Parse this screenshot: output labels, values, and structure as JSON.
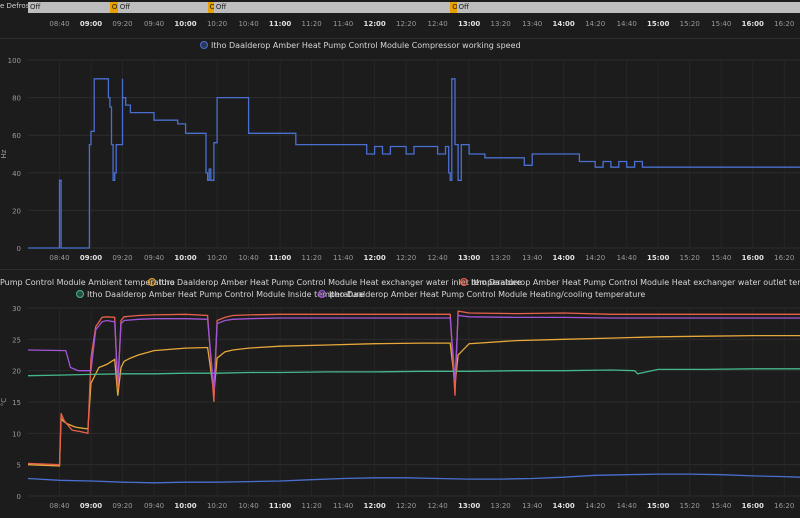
{
  "timeline": {
    "label": "e Defrost",
    "segments": [
      {
        "state": "Off",
        "start": "08:20",
        "end": "09:12"
      },
      {
        "state": "On",
        "start": "09:12",
        "end": "09:17"
      },
      {
        "state": "Off",
        "start": "09:17",
        "end": "10:14"
      },
      {
        "state": "On",
        "start": "10:14",
        "end": "10:18"
      },
      {
        "state": "Off",
        "start": "10:18",
        "end": "12:48"
      },
      {
        "state": "On",
        "start": "12:48",
        "end": "12:52"
      },
      {
        "state": "Off",
        "start": "12:52",
        "end": "16:30"
      }
    ],
    "ticks": [
      "08:40",
      "09:00",
      "09:20",
      "09:40",
      "10:00",
      "10:20",
      "10:40",
      "11:00",
      "11:20",
      "11:40",
      "12:00",
      "12:20",
      "12:40",
      "13:00",
      "13:20",
      "13:40",
      "14:00",
      "14:20",
      "14:40",
      "15:00",
      "15:20",
      "15:40",
      "16:00",
      "16:20"
    ],
    "bold_ticks": [
      "09:00",
      "10:00",
      "11:00",
      "12:00",
      "13:00",
      "14:00",
      "15:00",
      "16:00"
    ]
  },
  "chart_data": [
    {
      "type": "line",
      "xlabel": "",
      "ylabel": "Hz",
      "ylim": [
        0,
        100
      ],
      "yticks": [
        0,
        20,
        40,
        60,
        80,
        100
      ],
      "xlim": [
        "08:20",
        "16:30"
      ],
      "x_ticks": [
        "08:40",
        "09:00",
        "09:20",
        "09:40",
        "10:00",
        "10:20",
        "10:40",
        "11:00",
        "11:20",
        "11:40",
        "12:00",
        "12:20",
        "12:40",
        "13:00",
        "13:20",
        "13:40",
        "14:00",
        "14:20",
        "14:40",
        "15:00",
        "15:20",
        "15:40",
        "16:00",
        "16:20"
      ],
      "step": true,
      "series": [
        {
          "name": "Itho Daalderop Amber Heat Pump Control Module Compressor working speed",
          "color": "#4a6fd1",
          "x": [
            "08:20",
            "08:40",
            "08:40",
            "08:41",
            "08:41",
            "08:58",
            "08:59",
            "09:00",
            "09:01",
            "09:02",
            "09:10",
            "09:11",
            "09:12",
            "09:13",
            "09:14",
            "09:15",
            "09:16",
            "09:20",
            "09:20",
            "09:22",
            "09:25",
            "09:30",
            "09:40",
            "09:55",
            "10:00",
            "10:12",
            "10:13",
            "10:14",
            "10:15",
            "10:16",
            "10:18",
            "10:20",
            "10:40",
            "10:55",
            "11:10",
            "11:40",
            "11:55",
            "12:00",
            "12:05",
            "12:10",
            "12:20",
            "12:25",
            "12:35",
            "12:40",
            "12:45",
            "12:47",
            "12:48",
            "12:49",
            "12:51",
            "12:53",
            "12:55",
            "13:00",
            "13:10",
            "13:30",
            "13:35",
            "13:40",
            "14:10",
            "14:15",
            "14:20",
            "14:25",
            "14:30",
            "14:35",
            "14:40",
            "14:45",
            "14:50",
            "16:30"
          ],
          "y": [
            0,
            0,
            36,
            36,
            0,
            0,
            55,
            62,
            62,
            90,
            90,
            80,
            75,
            55,
            36,
            40,
            55,
            90,
            80,
            76,
            72,
            72,
            68,
            66,
            61,
            61,
            40,
            36,
            42,
            36,
            56,
            80,
            61,
            61,
            55,
            55,
            50,
            54,
            50,
            54,
            50,
            54,
            54,
            50,
            54,
            40,
            36,
            90,
            55,
            36,
            55,
            50,
            48,
            48,
            44,
            50,
            46,
            46,
            43,
            46,
            43,
            46,
            43,
            46,
            43,
            43
          ]
        }
      ]
    },
    {
      "type": "line",
      "xlabel": "",
      "ylabel": "°C",
      "ylim": [
        0,
        30
      ],
      "yticks": [
        0,
        5,
        10,
        15,
        20,
        25,
        30
      ],
      "xlim": [
        "08:20",
        "16:30"
      ],
      "x_ticks": [
        "08:40",
        "09:00",
        "09:20",
        "09:40",
        "10:00",
        "10:20",
        "10:40",
        "11:00",
        "11:20",
        "11:40",
        "12:00",
        "12:20",
        "12:40",
        "13:00",
        "13:20",
        "13:40",
        "14:00",
        "14:20",
        "14:40",
        "15:00",
        "15:20",
        "15:40",
        "16:00",
        "16:20"
      ],
      "series": [
        {
          "name": "Pump Control Module Ambient temperature",
          "color": "#4a6fd1",
          "x": [
            "08:20",
            "08:40",
            "09:00",
            "09:20",
            "09:40",
            "10:00",
            "10:20",
            "10:40",
            "11:00",
            "11:20",
            "11:40",
            "12:00",
            "12:20",
            "12:40",
            "13:00",
            "13:20",
            "13:40",
            "14:00",
            "14:20",
            "14:40",
            "15:00",
            "15:20",
            "15:40",
            "16:00",
            "16:20",
            "16:30"
          ],
          "y": [
            2.8,
            2.5,
            2.4,
            2.2,
            2.1,
            2.2,
            2.2,
            2.3,
            2.4,
            2.6,
            2.8,
            2.9,
            2.9,
            2.8,
            2.7,
            2.7,
            2.8,
            3.0,
            3.3,
            3.4,
            3.5,
            3.5,
            3.4,
            3.2,
            3.1,
            3.0
          ]
        },
        {
          "name": "Itho Daalderop Amber Heat Pump Control Module Heat exchanger water inlet temperature",
          "color": "#e7a83a",
          "x": [
            "08:20",
            "08:40",
            "08:41",
            "08:42",
            "08:45",
            "08:50",
            "08:55",
            "08:58",
            "09:00",
            "09:05",
            "09:10",
            "09:15",
            "09:17",
            "09:19",
            "09:21",
            "09:25",
            "09:30",
            "09:40",
            "10:00",
            "10:14",
            "10:18",
            "10:20",
            "10:25",
            "10:30",
            "10:40",
            "11:00",
            "11:30",
            "12:00",
            "12:30",
            "12:48",
            "12:51",
            "12:53",
            "13:00",
            "13:30",
            "14:00",
            "14:30",
            "15:00",
            "15:30",
            "16:00",
            "16:30"
          ],
          "y": [
            5.0,
            4.8,
            12.5,
            12.0,
            11.5,
            11.0,
            10.8,
            10.7,
            18.0,
            20.5,
            21.0,
            21.8,
            16.0,
            20.5,
            21.5,
            22.0,
            22.5,
            23.2,
            23.6,
            23.7,
            16.5,
            22.0,
            23.0,
            23.3,
            23.6,
            23.9,
            24.1,
            24.3,
            24.4,
            24.4,
            17.8,
            22.5,
            24.3,
            24.8,
            25.0,
            25.2,
            25.4,
            25.5,
            25.6,
            25.6
          ]
        },
        {
          "name": "Itho Daalderop Amber Heat Pump Control Module Heat exchanger water outlet temperature",
          "color": "#e8604c",
          "x": [
            "08:20",
            "08:40",
            "08:41",
            "08:43",
            "08:48",
            "08:53",
            "08:58",
            "09:00",
            "09:03",
            "09:07",
            "09:10",
            "09:15",
            "09:17",
            "09:19",
            "09:21",
            "09:30",
            "09:40",
            "10:00",
            "10:14",
            "10:18",
            "10:20",
            "10:25",
            "10:30",
            "10:40",
            "11:00",
            "11:30",
            "12:00",
            "12:30",
            "12:48",
            "12:51",
            "12:53",
            "13:00",
            "13:30",
            "14:00",
            "14:30",
            "15:00",
            "15:30",
            "16:00",
            "16:30"
          ],
          "y": [
            5.2,
            5.0,
            13.2,
            12.0,
            10.5,
            10.3,
            10.0,
            22.0,
            27.0,
            28.5,
            28.6,
            28.5,
            17.0,
            28.0,
            28.6,
            28.8,
            28.9,
            29.0,
            28.8,
            15.0,
            28.0,
            28.5,
            28.8,
            28.9,
            29.0,
            29.0,
            29.0,
            29.0,
            29.0,
            16.0,
            29.5,
            29.2,
            29.1,
            29.2,
            29.0,
            29.0,
            29.0,
            29.0,
            29.0
          ]
        },
        {
          "name": "Itho Daalderop Amber Heat Pump Control Module Inside temperature",
          "color": "#45b88b",
          "x": [
            "08:20",
            "08:40",
            "09:00",
            "09:20",
            "09:40",
            "10:00",
            "10:20",
            "10:40",
            "11:00",
            "11:30",
            "12:00",
            "12:30",
            "13:00",
            "13:30",
            "14:00",
            "14:30",
            "14:45",
            "14:47",
            "15:00",
            "15:30",
            "16:00",
            "16:30"
          ],
          "y": [
            19.2,
            19.3,
            19.4,
            19.5,
            19.5,
            19.6,
            19.6,
            19.7,
            19.7,
            19.8,
            19.8,
            19.9,
            19.9,
            20.0,
            20.0,
            20.1,
            20.0,
            19.5,
            20.2,
            20.2,
            20.3,
            20.3
          ]
        },
        {
          "name": "Itho Daalderop Amber Heat Pump Control Module Heating/cooling temperature",
          "color": "#a056d8",
          "x": [
            "08:20",
            "08:44",
            "08:47",
            "08:52",
            "09:00",
            "09:03",
            "09:07",
            "09:10",
            "09:15",
            "09:17",
            "09:19",
            "09:21",
            "09:30",
            "09:40",
            "10:00",
            "10:14",
            "10:18",
            "10:20",
            "10:25",
            "10:30",
            "10:40",
            "11:00",
            "11:30",
            "12:00",
            "12:30",
            "12:48",
            "12:51",
            "12:53",
            "13:00",
            "13:30",
            "14:00",
            "14:30",
            "15:00",
            "15:30",
            "16:00",
            "16:30"
          ],
          "y": [
            23.3,
            23.2,
            20.5,
            20.0,
            20.0,
            26.5,
            27.8,
            28.0,
            27.8,
            18.0,
            27.5,
            28.0,
            28.2,
            28.3,
            28.3,
            28.2,
            17.0,
            27.5,
            28.0,
            28.2,
            28.3,
            28.4,
            28.4,
            28.4,
            28.4,
            28.4,
            18.5,
            28.8,
            28.6,
            28.5,
            28.5,
            28.4,
            28.4,
            28.4,
            28.4,
            28.4
          ]
        }
      ]
    }
  ]
}
